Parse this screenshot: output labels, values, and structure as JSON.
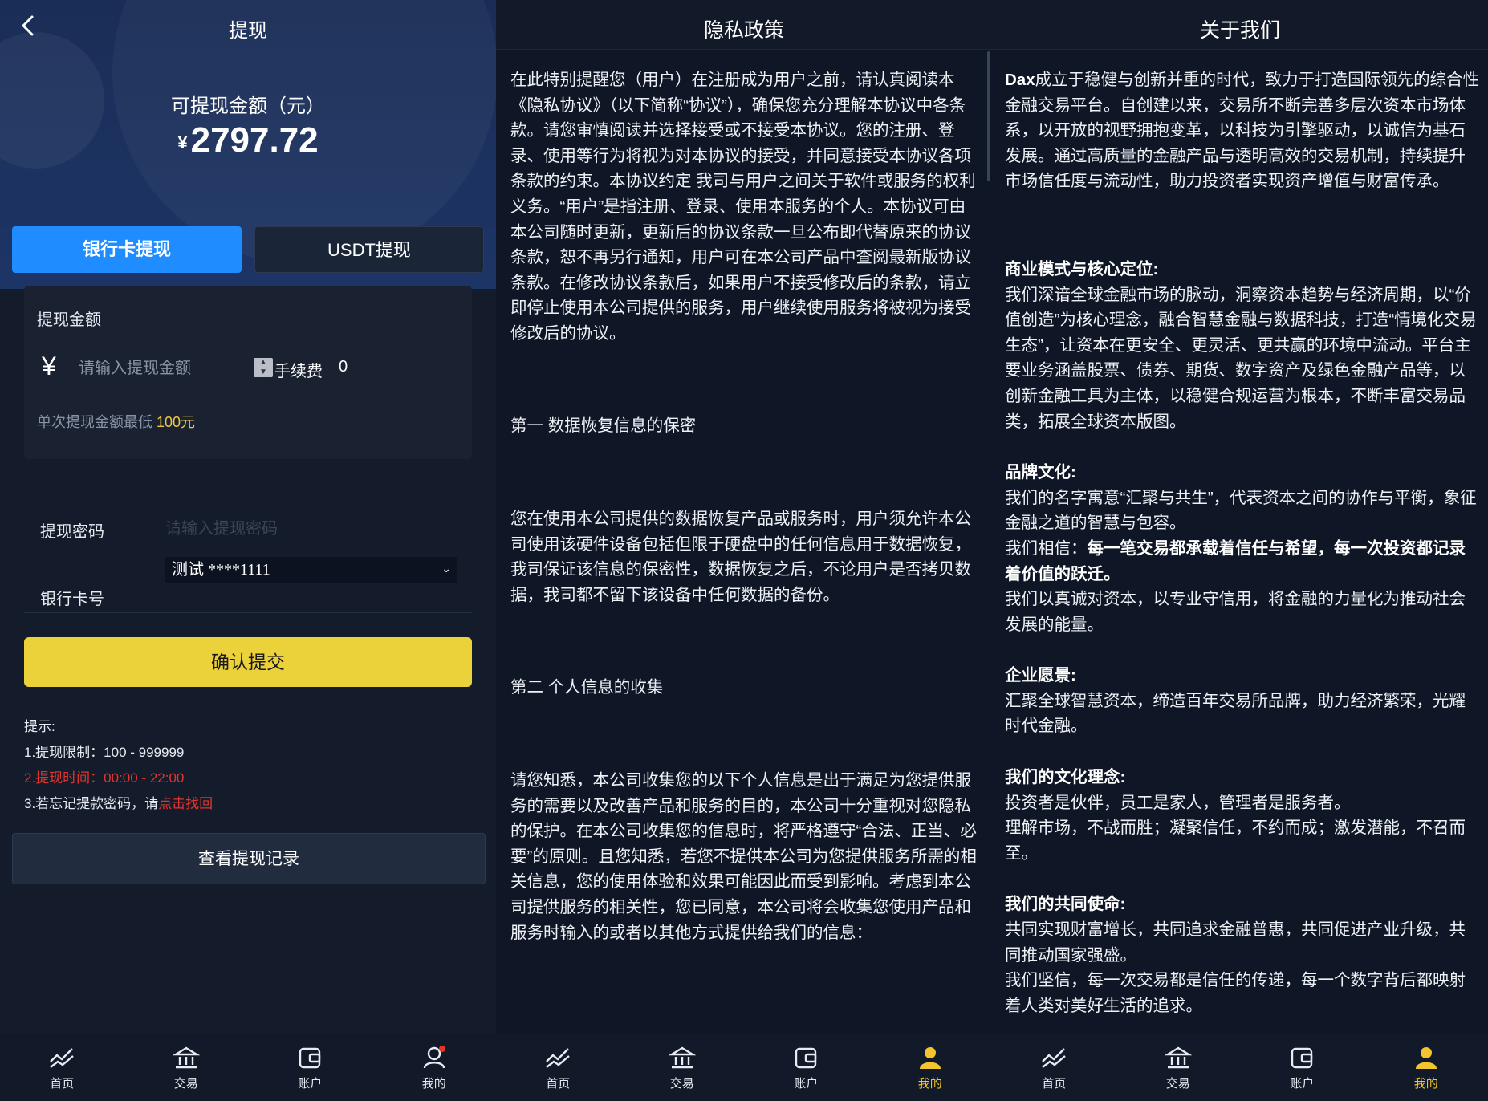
{
  "withdraw": {
    "title": "提现",
    "available_label": "可提现金额（元）",
    "currency_symbol": "¥",
    "balance": "2797.72",
    "tab_bank": "银行卡提现",
    "tab_usdt": "USDT提现",
    "amount_label": "提现金额",
    "amount_currency": "¥",
    "amount_placeholder": "请输入提现金额",
    "fee_label": "手续费",
    "fee_value": "0",
    "min_note_prefix": "单次提现金额最低",
    "min_note_value": "100元",
    "password_label": "提现密码",
    "password_placeholder": "请输入提现密码",
    "card_label": "银行卡号",
    "card_selected": "测试 ****1111",
    "confirm_label": "确认提交",
    "tips_title": "提示:",
    "tip1": "1.提现限制：100 - 999999",
    "tip2": "2.提现时间：00:00 - 22:00",
    "tip3_prefix": "3.若忘记提款密码，请",
    "tip3_link": "点击找回",
    "records_label": "查看提现记录"
  },
  "privacy": {
    "title": "隐私政策",
    "p1": "在此特别提醒您（用户）在注册成为用户之前，请认真阅读本《隐私协议》（以下简称“协议”），确保您充分理解本协议中各条款。请您审慎阅读并选择接受或不接受本协议。您的注册、登录、使用等行为将视为对本协议的接受，并同意接受本协议各项条款的约束。本协议约定 我司与用户之间关于软件或服务的权利义务。“用户”是指注册、登录、使用本服务的个人。本协议可由本公司随时更新，更新后的协议条款一旦公布即代替原来的协议条款，恕不再另行通知，用户可在本公司产品中查阅最新版协议条款。在修改协议条款后，如果用户不接受修改后的条款，请立即停止使用本公司提供的服务，用户继续使用服务将被视为接受修改后的协议。",
    "h1": "第一 数据恢复信息的保密",
    "p2": "您在使用本公司提供的数据恢复产品或服务时，用户须允许本公司使用该硬件设备包括但限于硬盘中的任何信息用于数据恢复，我司保证该信息的保密性，数据恢复之后，不论用户是否拷贝数据，我司都不留下该设备中任何数据的备份。",
    "h2": "第二 个人信息的收集",
    "p3": "请您知悉，本公司收集您的以下个人信息是出于满足为您提供服务的需要以及改善产品和服务的目的，本公司十分重视对您隐私的保护。在本公司收集您的信息时，将严格遵守“合法、正当、必要”的原则。且您知悉，若您不提供本公司为您提供服务所需的相关信息，您的使用体验和效果可能因此而受到影响。考虑到本公司提供服务的相关性，您已同意，本公司将会收集您使用产品和服务时输入的或者以其他方式提供给我们的信息："
  },
  "about": {
    "title": "关于我们",
    "intro_brand": "Dax",
    "intro": "成立于稳健与创新并重的时代，致力于打造国际领先的综合性金融交易平台。自创建以来，交易所不断完善多层次资本市场体系，以开放的视野拥抱变革，以科技为引擎驱动，以诚信为基石发展。通过高质量的金融产品与透明高效的交易机制，持续提升市场信任度与流动性，助力投资者实现资产增值与财富传承。",
    "biz_title": "商业模式与核心定位:",
    "biz_text": "我们深谙全球金融市场的脉动，洞察资本趋势与经济周期，以“价值创造”为核心理念，融合智慧金融与数据科技，打造“情境化交易生态”，让资本在更安全、更灵活、更共赢的环境中流动。平台主要业务涵盖股票、债券、期货、数字资产及绿色金融产品等，以创新金融工具为主体，以稳健合规运营为根本，不断丰富交易品类，拓展全球资本版图。",
    "brand_title": "品牌文化:",
    "brand_text1": "我们的名字寓意“汇聚与共生”，代表资本之间的协作与平衡，象征金融之道的智慧与包容。",
    "brand_text2_prefix": "我们相信：",
    "brand_text2_bold": "每一笔交易都承载着信任与希望，每一次投资都记录着价值的跃迁。",
    "brand_text3": "我们以真诚对资本，以专业守信用，将金融的力量化为推动社会发展的能量。",
    "vision_title": "企业愿景:",
    "vision_text": "汇聚全球智慧资本，缔造百年交易所品牌，助力经济繁荣，光耀时代金融。",
    "culture_title": "我们的文化理念:",
    "culture_text1": "投资者是伙伴，员工是家人，管理者是服务者。",
    "culture_text2": "理解市场，不战而胜；凝聚信任，不约而成；激发潜能，不召而至。",
    "mission_title": "我们的共同使命:",
    "mission_text1": "共同实现财富增长，共同追求金融普惠，共同促进产业升级，共同推动国家强盛。",
    "mission_text2": "我们坚信，每一次交易都是信任的传递，每一个数字背后都映射着人类对美好生活的追求。"
  },
  "nav": {
    "home": "首页",
    "trade": "交易",
    "account": "账户",
    "mine": "我的"
  },
  "colors": {
    "primary_blue": "#1f8cff",
    "accent_yellow": "#ecd23a",
    "active_tab": "#f2c42e",
    "alert_red": "#e2352f"
  }
}
